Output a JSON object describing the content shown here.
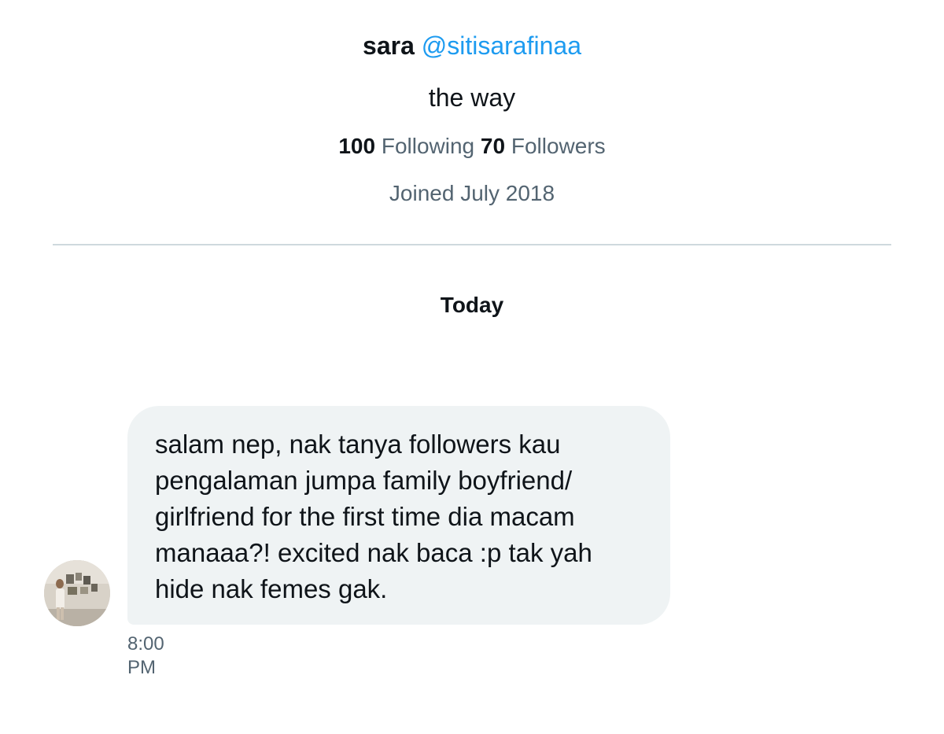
{
  "profile": {
    "display_name": "sara",
    "handle": "@sitisarafinaa",
    "bio": "the way",
    "following_count": "100",
    "following_label": "Following",
    "followers_count": "70",
    "followers_label": "Followers",
    "joined": "Joined July 2018"
  },
  "conversation": {
    "date_separator": "Today",
    "messages": [
      {
        "text": "salam nep, nak tanya followers kau pengalaman jumpa family boyfriend/ girlfriend for the first time dia macam manaaa?! excited nak baca :p tak yah hide nak femes gak.",
        "time": "8:00 PM"
      }
    ]
  },
  "colors": {
    "link": "#1d9bf0",
    "secondary_text": "#536471",
    "bubble_bg": "#eff3f4",
    "divider": "#cfd9de"
  }
}
